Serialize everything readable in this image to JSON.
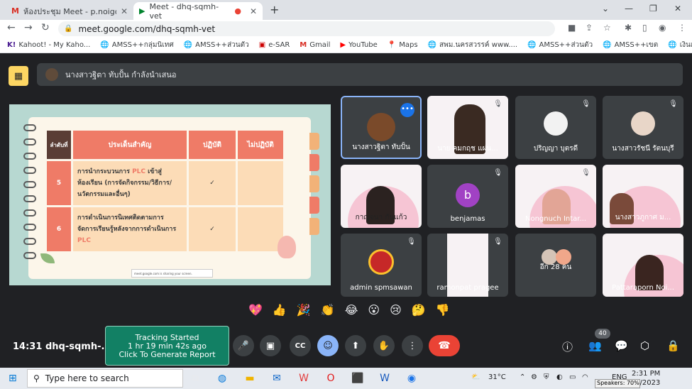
{
  "browser": {
    "tabs": [
      {
        "label": "ห้องประชุม Meet - p.noigor@gmai"
      },
      {
        "label": "Meet - dhq-sqmh-vet"
      }
    ],
    "url": "meet.google.com/dhq-sqmh-vet",
    "bookmarks": [
      "Kahoot! - My Kaho...",
      "AMSS++กลุ่มนิเทศ",
      "AMSS++ส่วนตัว",
      "e-SAR",
      "Gmail",
      "YouTube",
      "Maps",
      "สพม.นครสวรรค์ www....",
      "AMSS++ส่วนตัว",
      "AMSS++เขต",
      "เงินเดือน"
    ]
  },
  "meet": {
    "presenter": "นางสาวฐิตา ทับปั้น กำลังนำเสนอ",
    "slide": {
      "headers": [
        "ลำดับที่",
        "ประเด็นสำคัญ",
        "ปฏิบัติ",
        "ไม่ปฏิบัติ"
      ],
      "rows": [
        {
          "no": "5",
          "pre": "การนำกระบวนการ ",
          "hl": "PLC",
          "post": " เข้าสู่ห้องเรียน (การจัดกิจกรรม/วิธีการ/นวัตกรรมและอื่นๆ)",
          "check": "✓"
        },
        {
          "no": "6",
          "pre": "การดำเนินการนิเทศติดตามการจัดการเรียนรู้หลังจากการดำเนินการ ",
          "hl": "PLC",
          "post": "",
          "check": "✓"
        }
      ],
      "share_bar": "meet.google.com is sharing your screen."
    },
    "participants": [
      {
        "name": "นางสาวฐิตา ทับปั้น"
      },
      {
        "name": "นาย คมกฤช แผ่น..."
      },
      {
        "name": "ปริญญา บุตรดี"
      },
      {
        "name": "นางสาวรัชนี รัตนบุรี"
      },
      {
        "name": "กาญจนา กันแก้ว"
      },
      {
        "name": "benjamas",
        "initial": "b"
      },
      {
        "name": "Nongnuch Intar..."
      },
      {
        "name": "นางสาวภูกาศ ม..."
      },
      {
        "name": "admin spmsawan"
      },
      {
        "name": "ramonpat pragee"
      },
      {
        "name": "อีก 28 คน"
      },
      {
        "name": "Pattaraporn Noi..."
      }
    ],
    "reactions": [
      "💖",
      "👍",
      "🎉",
      "👏",
      "😂",
      "😮",
      "😢",
      "🤔",
      "👎"
    ],
    "time": "14:31",
    "code": "dhq-sqmh-...",
    "tracking": [
      "Tracking Started",
      "1 hr 19 min 42s ago",
      "Click To Generate Report"
    ],
    "people_count": "40"
  },
  "taskbar": {
    "search_placeholder": "Type here to search",
    "weather": "31°C",
    "time": "2:31 PM",
    "date": "/2023",
    "lang": "ENG",
    "speakers": "Speakers: 70%"
  }
}
